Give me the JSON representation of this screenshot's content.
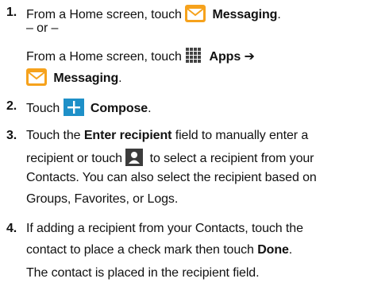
{
  "steps": [
    {
      "num": "1.",
      "l1_a": "From a Home screen, touch ",
      "l1_b": "Messaging",
      "l1_c": ".",
      "or": "– or –",
      "l2_a": "From a Home screen, touch ",
      "l2_b": "Apps",
      "l2_c": " ➔",
      "l3_b": "Messaging",
      "l3_c": "."
    },
    {
      "num": "2.",
      "a": "Touch ",
      "b": "Compose",
      "c": "."
    },
    {
      "num": "3.",
      "l1_a": "Touch the ",
      "l1_b": "Enter recipient",
      "l1_c": " field to manually enter a",
      "l2_a": "recipient or touch ",
      "l2_c": " to select a recipient from your",
      "l3": "Contacts. You can also select the recipient based on",
      "l4": "Groups, Favorites, or Logs."
    },
    {
      "num": "4.",
      "l1": "If adding a recipient from your Contacts, touch the",
      "l2_a": "contact to place a check mark then touch ",
      "l2_b": "Done",
      "l2_c": ".",
      "l3": "The contact is placed in the recipient field."
    }
  ],
  "icons": {
    "messaging": "messaging-envelope-icon",
    "apps": "apps-grid-icon",
    "compose": "compose-plus-icon",
    "contact": "contact-person-icon"
  },
  "colors": {
    "messaging_bg": "#f6a21c",
    "compose_bg": "#1e90c8",
    "contact_bg": "#3c3c3c"
  }
}
